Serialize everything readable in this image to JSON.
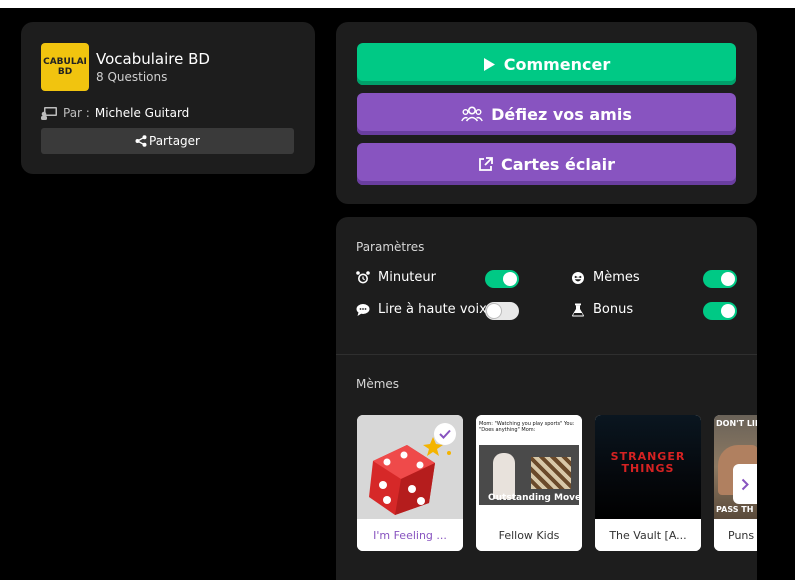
{
  "quiz": {
    "thumb_line1": "CABULAI",
    "thumb_line2": "BD",
    "title": "Vocabulaire BD",
    "questions": "8 Questions",
    "by_label": "Par :",
    "author": "Michele Guitard",
    "share_label": "Partager"
  },
  "actions": {
    "start_label": "Commencer",
    "challenge_label": "Défiez vos amis",
    "flashcards_label": "Cartes éclair"
  },
  "settings": {
    "title": "Paramètres",
    "options": [
      {
        "label": "Minuteur",
        "on": true,
        "icon": "alarm-clock-icon"
      },
      {
        "label": "Mèmes",
        "on": true,
        "icon": "laughing-face-icon"
      },
      {
        "label": "Lire à haute voix",
        "on": false,
        "icon": "speech-bubble-icon"
      },
      {
        "label": "Bonus",
        "on": true,
        "icon": "flask-icon"
      }
    ]
  },
  "memes": {
    "title": "Mèmes",
    "items": [
      {
        "caption": "I'm Feeling ...",
        "selected": true
      },
      {
        "caption": "Fellow Kids",
        "selected": false,
        "overlay_text": "Mom: \"Watching you play sports\" You: \"Does anything\" Mom:",
        "overlay_bottom": "Outstanding Move"
      },
      {
        "caption": "The Vault [A...",
        "selected": false,
        "overlay_text": "STRANGER THINGS"
      },
      {
        "caption": "Puns",
        "selected": false,
        "overlay_text": "DON'T LIK",
        "overlay_bottom": "PASS TH"
      }
    ]
  },
  "colors": {
    "green": "#00c985",
    "purple": "#8854c0",
    "card": "#1d1d1d"
  }
}
